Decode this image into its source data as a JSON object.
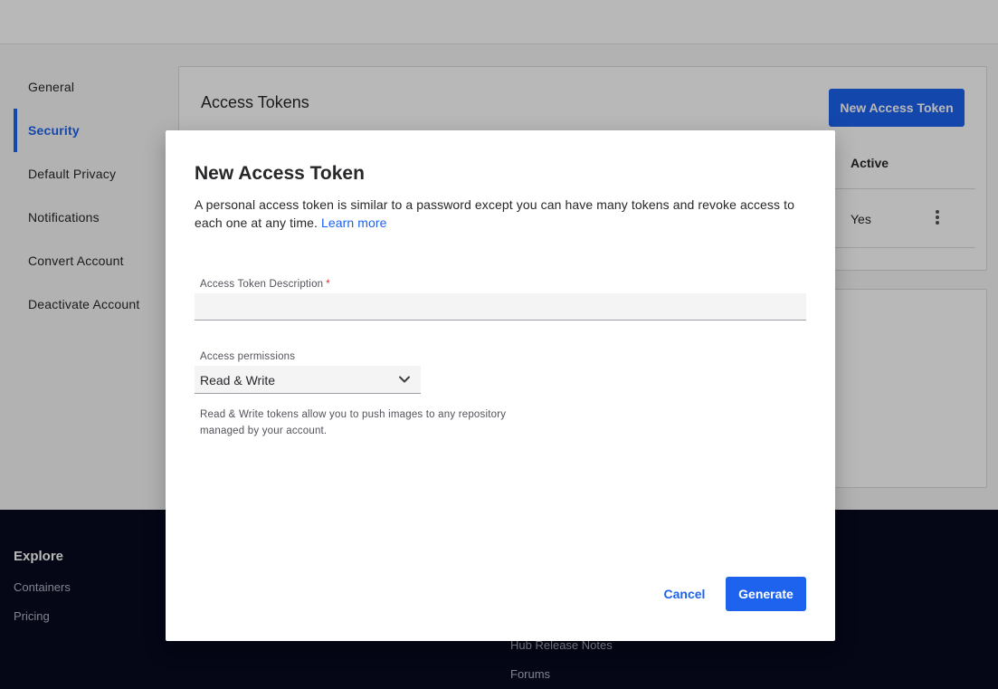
{
  "sidebar": {
    "items": [
      {
        "label": "General"
      },
      {
        "label": "Security"
      },
      {
        "label": "Default Privacy"
      },
      {
        "label": "Notifications"
      },
      {
        "label": "Convert Account"
      },
      {
        "label": "Deactivate Account"
      }
    ],
    "active": "Security"
  },
  "tokens_card": {
    "title": "Access Tokens",
    "new_button": "New Access Token",
    "column_active": "Active",
    "row_active_value": "Yes"
  },
  "footer": {
    "explore_heading": "Explore",
    "explore_links": [
      "Containers",
      "Pricing"
    ],
    "other_links": [
      "Hub Release Notes",
      "Forums"
    ]
  },
  "modal": {
    "title": "New Access Token",
    "description": "A personal access token is similar to a password except you can have many tokens and revoke access to each one at any time.",
    "learn_more": "Learn more",
    "description_label": "Access Token Description",
    "required_mark": "*",
    "description_value": "",
    "permissions_label": "Access permissions",
    "permissions_value": "Read & Write",
    "permissions_help": "Read & Write tokens allow you to push images to any repository managed by your account.",
    "cancel_label": "Cancel",
    "generate_label": "Generate"
  },
  "colors": {
    "accent": "#1d63ed",
    "footer_bg": "#07091f",
    "required": "#d32f2f"
  }
}
